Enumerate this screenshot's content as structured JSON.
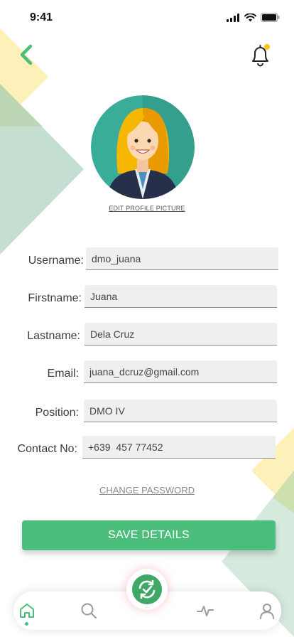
{
  "status_bar": {
    "time": "9:41"
  },
  "profile": {
    "edit_picture_label": "EDIT PROFILE PICTURE"
  },
  "form": {
    "username": {
      "label": "Username:",
      "value": "dmo_juana"
    },
    "firstname": {
      "label": "Firstname:",
      "value": "Juana"
    },
    "lastname": {
      "label": "Lastname:",
      "value": "Dela Cruz"
    },
    "email": {
      "label": "Email:",
      "value": "juana_dcruz@gmail.com"
    },
    "position": {
      "label": "Position:",
      "value": "DMO IV"
    },
    "contact": {
      "label": "Contact No:",
      "value": "+639  457 77452"
    }
  },
  "change_password_label": "CHANGE PASSWORD",
  "save_label": "SAVE DETAILS",
  "colors": {
    "accent": "#4cbe7c",
    "notification_dot": "#f5c518",
    "deco_yellow": "#fdf0b8",
    "deco_green": "#bedbcc"
  },
  "icons": {
    "back": "chevron-left-icon",
    "bell": "bell-icon",
    "home": "home-icon",
    "search": "search-icon",
    "activity": "activity-icon",
    "profile": "user-icon",
    "fab": "sync-check-icon"
  },
  "nav": {
    "active": "home"
  }
}
